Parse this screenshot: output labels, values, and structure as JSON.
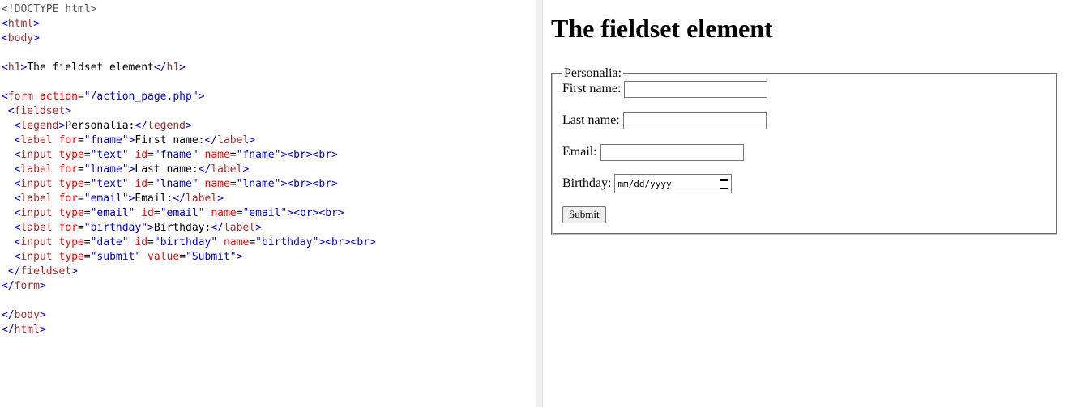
{
  "code": {
    "lines": [
      [
        [
          "cm",
          "<!DOCTYPE html>"
        ]
      ],
      [
        [
          "ang",
          "<"
        ],
        [
          "tag",
          "html"
        ],
        [
          "ang",
          ">"
        ]
      ],
      [
        [
          "ang",
          "<"
        ],
        [
          "tag",
          "body"
        ],
        [
          "ang",
          ">"
        ]
      ],
      [],
      [
        [
          "ang",
          "<"
        ],
        [
          "tag",
          "h1"
        ],
        [
          "ang",
          ">"
        ],
        [
          "txt",
          "The fieldset element"
        ],
        [
          "ang",
          "</"
        ],
        [
          "tag",
          "h1"
        ],
        [
          "ang",
          ">"
        ]
      ],
      [],
      [
        [
          "ang",
          "<"
        ],
        [
          "tag",
          "form"
        ],
        [
          "txt",
          " "
        ],
        [
          "attr",
          "action"
        ],
        [
          "txt",
          "="
        ],
        [
          "val",
          "\"/action_page.php\""
        ],
        [
          "ang",
          ">"
        ]
      ],
      [
        [
          "txt",
          " "
        ],
        [
          "ang",
          "<"
        ],
        [
          "tag",
          "fieldset"
        ],
        [
          "ang",
          ">"
        ]
      ],
      [
        [
          "txt",
          "  "
        ],
        [
          "ang",
          "<"
        ],
        [
          "tag",
          "legend"
        ],
        [
          "ang",
          ">"
        ],
        [
          "txt",
          "Personalia:"
        ],
        [
          "ang",
          "</"
        ],
        [
          "tag",
          "legend"
        ],
        [
          "ang",
          ">"
        ]
      ],
      [
        [
          "txt",
          "  "
        ],
        [
          "ang",
          "<"
        ],
        [
          "tag",
          "label"
        ],
        [
          "txt",
          " "
        ],
        [
          "attr",
          "for"
        ],
        [
          "txt",
          "="
        ],
        [
          "val",
          "\"fname\""
        ],
        [
          "ang",
          ">"
        ],
        [
          "txt",
          "First name:"
        ],
        [
          "ang",
          "</"
        ],
        [
          "tag",
          "label"
        ],
        [
          "ang",
          ">"
        ]
      ],
      [
        [
          "txt",
          "  "
        ],
        [
          "ang",
          "<"
        ],
        [
          "tag",
          "input"
        ],
        [
          "txt",
          " "
        ],
        [
          "attr",
          "type"
        ],
        [
          "txt",
          "="
        ],
        [
          "val",
          "\"text\""
        ],
        [
          "txt",
          " "
        ],
        [
          "attr",
          "id"
        ],
        [
          "txt",
          "="
        ],
        [
          "val",
          "\"fname\""
        ],
        [
          "txt",
          " "
        ],
        [
          "attr",
          "name"
        ],
        [
          "txt",
          "="
        ],
        [
          "val",
          "\"fname\""
        ],
        [
          "ang",
          "><br><br>"
        ]
      ],
      [
        [
          "txt",
          "  "
        ],
        [
          "ang",
          "<"
        ],
        [
          "tag",
          "label"
        ],
        [
          "txt",
          " "
        ],
        [
          "attr",
          "for"
        ],
        [
          "txt",
          "="
        ],
        [
          "val",
          "\"lname\""
        ],
        [
          "ang",
          ">"
        ],
        [
          "txt",
          "Last name:"
        ],
        [
          "ang",
          "</"
        ],
        [
          "tag",
          "label"
        ],
        [
          "ang",
          ">"
        ]
      ],
      [
        [
          "txt",
          "  "
        ],
        [
          "ang",
          "<"
        ],
        [
          "tag",
          "input"
        ],
        [
          "txt",
          " "
        ],
        [
          "attr",
          "type"
        ],
        [
          "txt",
          "="
        ],
        [
          "val",
          "\"text\""
        ],
        [
          "txt",
          " "
        ],
        [
          "attr",
          "id"
        ],
        [
          "txt",
          "="
        ],
        [
          "val",
          "\"lname\""
        ],
        [
          "txt",
          " "
        ],
        [
          "attr",
          "name"
        ],
        [
          "txt",
          "="
        ],
        [
          "val",
          "\"lname\""
        ],
        [
          "ang",
          "><br><br>"
        ]
      ],
      [
        [
          "txt",
          "  "
        ],
        [
          "ang",
          "<"
        ],
        [
          "tag",
          "label"
        ],
        [
          "txt",
          " "
        ],
        [
          "attr",
          "for"
        ],
        [
          "txt",
          "="
        ],
        [
          "val",
          "\"email\""
        ],
        [
          "ang",
          ">"
        ],
        [
          "txt",
          "Email:"
        ],
        [
          "ang",
          "</"
        ],
        [
          "tag",
          "label"
        ],
        [
          "ang",
          ">"
        ]
      ],
      [
        [
          "txt",
          "  "
        ],
        [
          "ang",
          "<"
        ],
        [
          "tag",
          "input"
        ],
        [
          "txt",
          " "
        ],
        [
          "attr",
          "type"
        ],
        [
          "txt",
          "="
        ],
        [
          "val",
          "\"email\""
        ],
        [
          "txt",
          " "
        ],
        [
          "attr",
          "id"
        ],
        [
          "txt",
          "="
        ],
        [
          "val",
          "\"email\""
        ],
        [
          "txt",
          " "
        ],
        [
          "attr",
          "name"
        ],
        [
          "txt",
          "="
        ],
        [
          "val",
          "\"email\""
        ],
        [
          "ang",
          "><br><br>"
        ]
      ],
      [
        [
          "txt",
          "  "
        ],
        [
          "ang",
          "<"
        ],
        [
          "tag",
          "label"
        ],
        [
          "txt",
          " "
        ],
        [
          "attr",
          "for"
        ],
        [
          "txt",
          "="
        ],
        [
          "val",
          "\"birthday\""
        ],
        [
          "ang",
          ">"
        ],
        [
          "txt",
          "Birthday:"
        ],
        [
          "ang",
          "</"
        ],
        [
          "tag",
          "label"
        ],
        [
          "ang",
          ">"
        ]
      ],
      [
        [
          "txt",
          "  "
        ],
        [
          "ang",
          "<"
        ],
        [
          "tag",
          "input"
        ],
        [
          "txt",
          " "
        ],
        [
          "attr",
          "type"
        ],
        [
          "txt",
          "="
        ],
        [
          "val",
          "\"date\""
        ],
        [
          "txt",
          " "
        ],
        [
          "attr",
          "id"
        ],
        [
          "txt",
          "="
        ],
        [
          "val",
          "\"birthday\""
        ],
        [
          "txt",
          " "
        ],
        [
          "attr",
          "name"
        ],
        [
          "txt",
          "="
        ],
        [
          "val",
          "\"birthday\""
        ],
        [
          "ang",
          "><br><br>"
        ]
      ],
      [
        [
          "txt",
          "  "
        ],
        [
          "ang",
          "<"
        ],
        [
          "tag",
          "input"
        ],
        [
          "txt",
          " "
        ],
        [
          "attr",
          "type"
        ],
        [
          "txt",
          "="
        ],
        [
          "val",
          "\"submit\""
        ],
        [
          "txt",
          " "
        ],
        [
          "attr",
          "value"
        ],
        [
          "txt",
          "="
        ],
        [
          "val",
          "\"Submit\""
        ],
        [
          "ang",
          ">"
        ]
      ],
      [
        [
          "txt",
          " "
        ],
        [
          "ang",
          "</"
        ],
        [
          "tag",
          "fieldset"
        ],
        [
          "ang",
          ">"
        ]
      ],
      [
        [
          "ang",
          "</"
        ],
        [
          "tag",
          "form"
        ],
        [
          "ang",
          ">"
        ]
      ],
      [],
      [
        [
          "ang",
          "</"
        ],
        [
          "tag",
          "body"
        ],
        [
          "ang",
          ">"
        ]
      ],
      [
        [
          "ang",
          "</"
        ],
        [
          "tag",
          "html"
        ],
        [
          "ang",
          ">"
        ]
      ]
    ]
  },
  "result": {
    "heading": "The fieldset element",
    "legend": "Personalia:",
    "first_name_label": "First name:",
    "last_name_label": "Last name:",
    "email_label": "Email:",
    "birthday_label": "Birthday:",
    "birthday_placeholder": "mm/dd/yyyy",
    "submit_label": "Submit"
  },
  "icons": {
    "birthday_picker": "calendar-icon"
  }
}
